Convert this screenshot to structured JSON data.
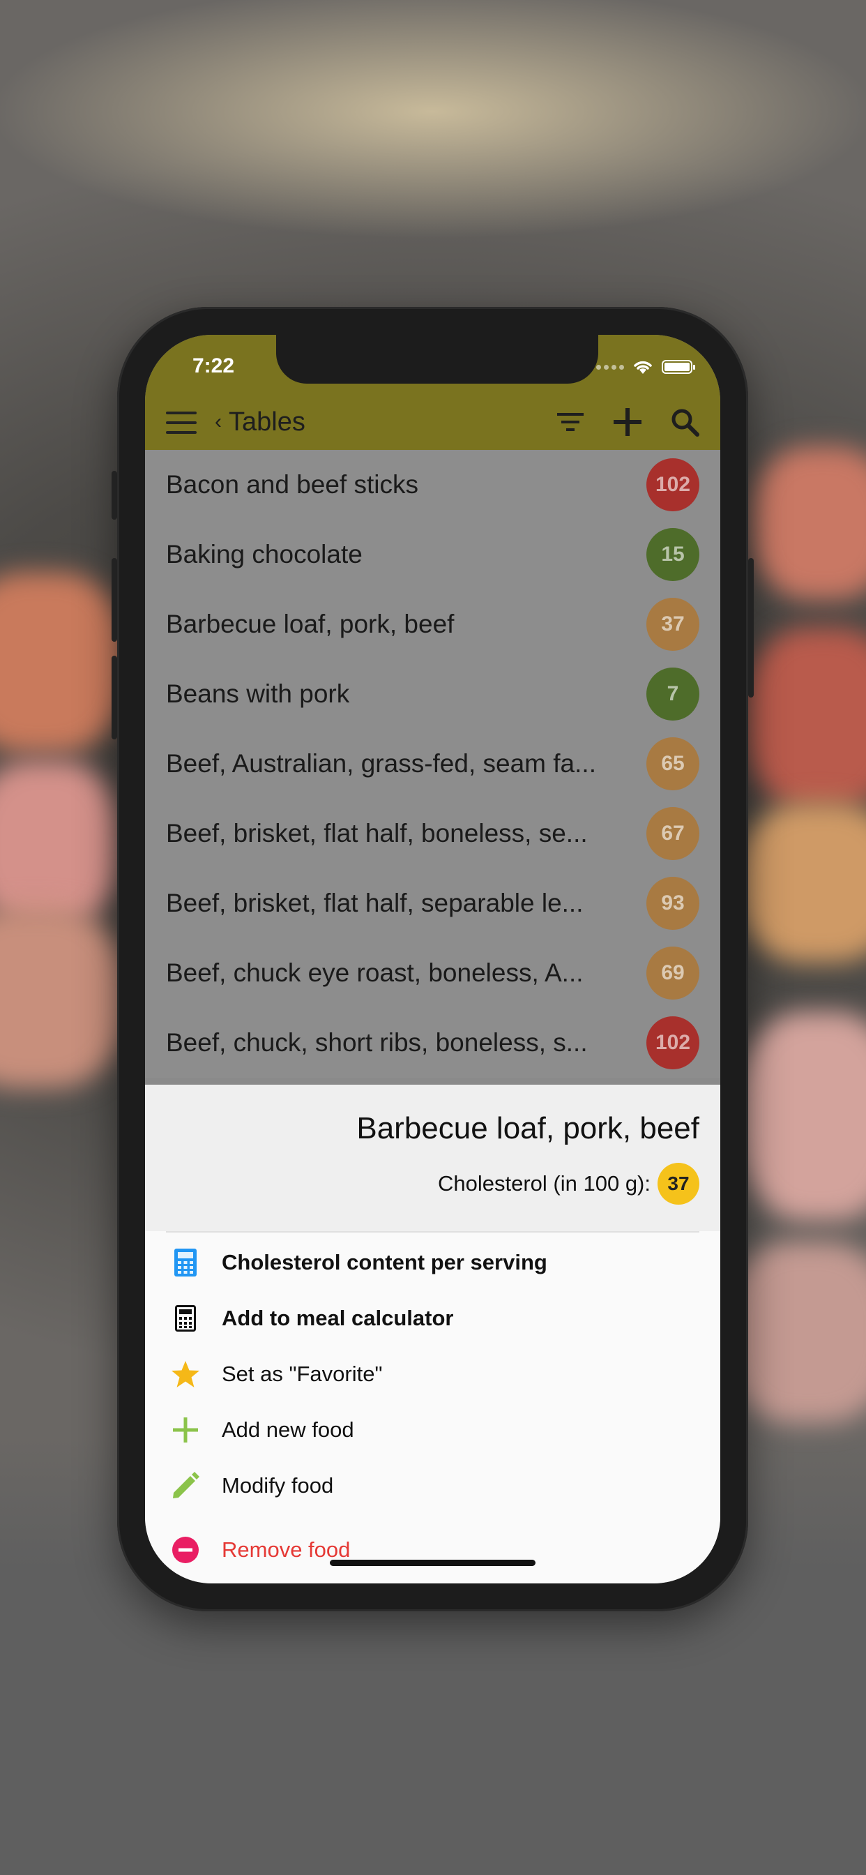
{
  "status_bar": {
    "time": "7:22"
  },
  "toolbar": {
    "back_label": "Tables",
    "icons": [
      "menu-icon",
      "filter-icon",
      "plus-icon",
      "search-icon"
    ]
  },
  "food_list": [
    {
      "name": "Bacon and beef sticks",
      "value": "102",
      "level": "high",
      "color": "#a8302c"
    },
    {
      "name": "Baking chocolate",
      "value": "15",
      "level": "low",
      "color": "#4e6c2a"
    },
    {
      "name": "Barbecue loaf, pork, beef",
      "value": "37",
      "level": "medium",
      "color": "#a87a42"
    },
    {
      "name": "Beans with pork",
      "value": "7",
      "level": "low",
      "color": "#4e6c2a"
    },
    {
      "name": "Beef, Australian, grass-fed, seam fa...",
      "value": "65",
      "level": "medium",
      "color": "#a87a42"
    },
    {
      "name": "Beef, brisket, flat half, boneless, se...",
      "value": "67",
      "level": "medium",
      "color": "#a87a42"
    },
    {
      "name": "Beef, brisket, flat half, separable le...",
      "value": "93",
      "level": "medium",
      "color": "#a87a42"
    },
    {
      "name": "Beef, chuck eye roast, boneless, A...",
      "value": "69",
      "level": "medium",
      "color": "#a87a42"
    },
    {
      "name": "Beef, chuck, short ribs, boneless, s...",
      "value": "102",
      "level": "high",
      "color": "#a8302c"
    }
  ],
  "sheet": {
    "title": "Barbecue loaf, pork, beef",
    "cholesterol_label": "Cholesterol (in 100 g):",
    "cholesterol_value": "37",
    "badge_color": "#f5c21b",
    "actions": [
      {
        "label": "Cholesterol content per serving",
        "icon": "calculator-blue-icon",
        "bold": true
      },
      {
        "label": "Add to meal calculator",
        "icon": "calculator-icon",
        "bold": true
      },
      {
        "label": "Set as \"Favorite\"",
        "icon": "star-icon",
        "bold": false
      },
      {
        "label": "Add new food",
        "icon": "plus-icon",
        "bold": false
      },
      {
        "label": "Modify food",
        "icon": "pencil-icon",
        "bold": false
      },
      {
        "label": "Remove food",
        "icon": "remove-icon",
        "bold": false,
        "color": "#e53935"
      }
    ]
  },
  "colors": {
    "app_bar": "#7a731f",
    "high": "#a8302c",
    "medium": "#a87a42",
    "low": "#4e6c2a",
    "accent_blue": "#2196f3",
    "accent_green": "#8bc34a",
    "accent_red": "#e91e63"
  }
}
